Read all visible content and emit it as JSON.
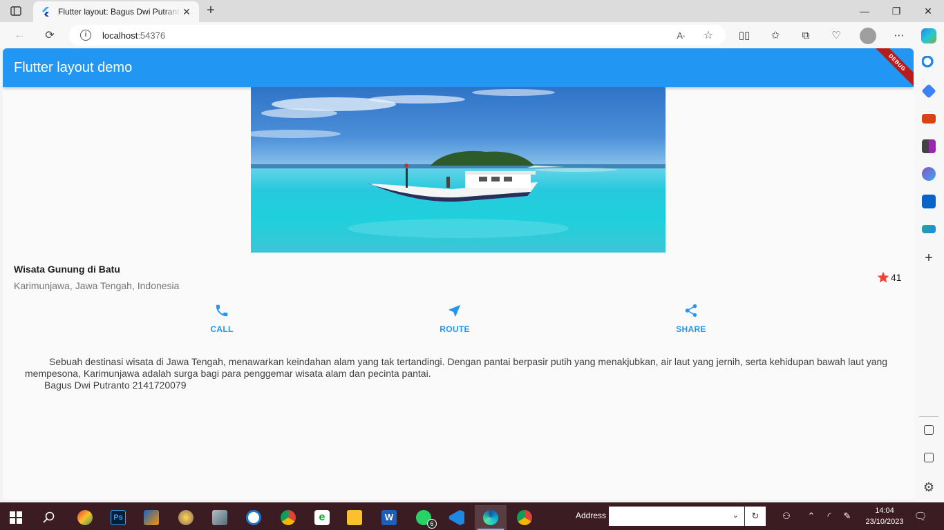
{
  "browser": {
    "tab_title": "Flutter layout: Bagus Dwi Putranto",
    "url_host": "localhost",
    "url_port": ":54376"
  },
  "app": {
    "title": "Flutter layout demo",
    "debug_banner": "DEBUG",
    "place_title": "Wisata Gunung di Batu",
    "place_subtitle": "Karimunjawa, Jawa Tengah, Indonesia",
    "rating": "41",
    "actions": [
      {
        "label": "CALL",
        "icon": "phone-icon"
      },
      {
        "label": "ROUTE",
        "icon": "near-me-icon"
      },
      {
        "label": "SHARE",
        "icon": "share-icon"
      }
    ],
    "description": "Sebuah destinasi wisata di Jawa Tengah, menawarkan keindahan alam yang tak tertandingi. Dengan pantai berpasir putih yang menakjubkan, air laut yang jernih, serta kehidupan bawah laut yang mempesona, Karimunjawa adalah surga bagi para penggemar wisata alam dan pecinta pantai.",
    "author": "Bagus Dwi Putranto 2141720079",
    "accent_color": "#2196f3",
    "star_color": "#f44336"
  },
  "taskbar": {
    "address_label": "Address",
    "whatsapp_badge": "6",
    "time": "14:04",
    "date": "23/10/2023"
  }
}
